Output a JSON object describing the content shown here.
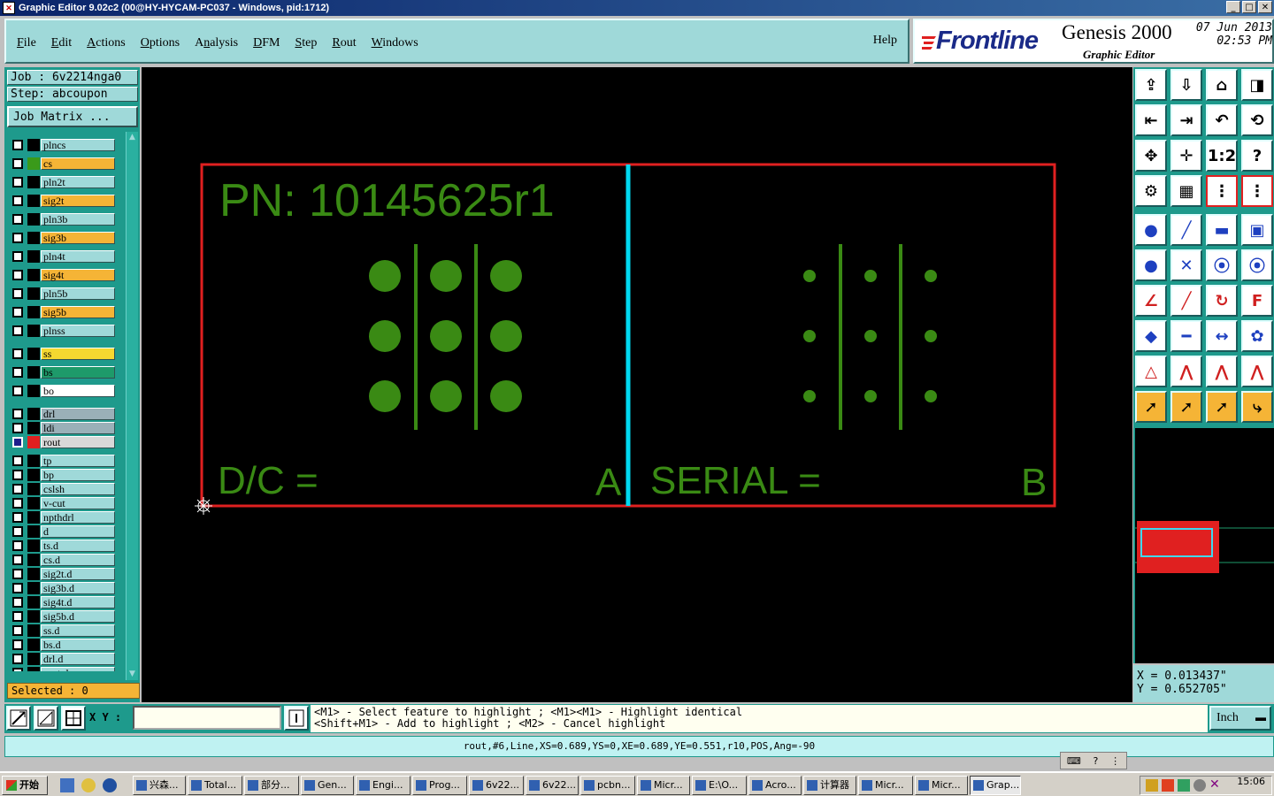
{
  "window": {
    "title": "Graphic Editor 9.02c2 (00@HY-HYCAM-PC037 - Windows, pid:1712)",
    "buttons": [
      "_",
      "□",
      "✕"
    ]
  },
  "menu": {
    "items": [
      {
        "label": "File",
        "u": "F"
      },
      {
        "label": "Edit",
        "u": "E"
      },
      {
        "label": "Actions",
        "u": "A"
      },
      {
        "label": "Options",
        "u": "O"
      },
      {
        "label": "Analysis",
        "u": "n"
      },
      {
        "label": "DFM",
        "u": "D"
      },
      {
        "label": "Step",
        "u": "S"
      },
      {
        "label": "Rout",
        "u": "R"
      },
      {
        "label": "Windows",
        "u": "W"
      }
    ],
    "help": "Help"
  },
  "logo": {
    "brand": "Frontline",
    "product": "Genesis 2000",
    "subtitle": "Graphic Editor",
    "date": "07 Jun 2013",
    "time": "02:53 PM"
  },
  "job": {
    "job_label": "Job : 6v2214nga0",
    "step_label": "Step: abcoupon",
    "matrix_button": "Job Matrix ..."
  },
  "layers": [
    {
      "name": "plncs",
      "color": "#000000",
      "bg": "#9fd9d9"
    },
    {
      "name": "cs",
      "color": "#3a9a1a",
      "bg": "#f5b436"
    },
    {
      "name": "pln2t",
      "color": "#000000",
      "bg": "#9fd9d9"
    },
    {
      "name": "sig2t",
      "color": "#000000",
      "bg": "#f5b436"
    },
    {
      "name": "pln3b",
      "color": "#000000",
      "bg": "#9fd9d9"
    },
    {
      "name": "sig3b",
      "color": "#000000",
      "bg": "#f5b436"
    },
    {
      "name": "pln4t",
      "color": "#000000",
      "bg": "#9fd9d9"
    },
    {
      "name": "sig4t",
      "color": "#000000",
      "bg": "#f5b436"
    },
    {
      "name": "pln5b",
      "color": "#000000",
      "bg": "#9fd9d9"
    },
    {
      "name": "sig5b",
      "color": "#000000",
      "bg": "#f5b436"
    },
    {
      "name": "plnss",
      "color": "#000000",
      "bg": "#9fd9d9"
    },
    {
      "name": "ss",
      "color": "#000000",
      "bg": "#f5d830"
    },
    {
      "name": "bs",
      "color": "#000000",
      "bg": "#1e9a6a"
    },
    {
      "name": "bo",
      "color": "#000000",
      "bg": "#ffffff"
    },
    {
      "name": "drl",
      "color": "#000000",
      "bg": "#9ab0b8"
    },
    {
      "name": "ldi",
      "color": "#000000",
      "bg": "#9ab0b8"
    },
    {
      "name": "rout",
      "color": "#e02020",
      "bg": "#d8d8d8",
      "selected": true
    },
    {
      "name": "tp",
      "color": "#000000",
      "bg": "#9fd9d9"
    },
    {
      "name": "bp",
      "color": "#000000",
      "bg": "#9fd9d9"
    },
    {
      "name": "cslsh",
      "color": "#000000",
      "bg": "#9fd9d9"
    },
    {
      "name": "v-cut",
      "color": "#000000",
      "bg": "#9fd9d9"
    },
    {
      "name": "npthdrl",
      "color": "#000000",
      "bg": "#9fd9d9"
    },
    {
      "name": "d",
      "color": "#000000",
      "bg": "#9fd9d9"
    },
    {
      "name": "ts.d",
      "color": "#000000",
      "bg": "#9fd9d9"
    },
    {
      "name": "cs.d",
      "color": "#000000",
      "bg": "#9fd9d9"
    },
    {
      "name": "sig2t.d",
      "color": "#000000",
      "bg": "#9fd9d9"
    },
    {
      "name": "sig3b.d",
      "color": "#000000",
      "bg": "#9fd9d9"
    },
    {
      "name": "sig4t.d",
      "color": "#000000",
      "bg": "#9fd9d9"
    },
    {
      "name": "sig5b.d",
      "color": "#000000",
      "bg": "#9fd9d9"
    },
    {
      "name": "ss.d",
      "color": "#000000",
      "bg": "#9fd9d9"
    },
    {
      "name": "bs.d",
      "color": "#000000",
      "bg": "#9fd9d9"
    },
    {
      "name": "drl.d",
      "color": "#000000",
      "bg": "#9fd9d9"
    },
    {
      "name": "rout.d",
      "color": "#000000",
      "bg": "#9fd9d9"
    }
  ],
  "selected_count": "Selected : 0",
  "board": {
    "pn_text": "PN: 10145625r1",
    "dc_text": "D/C =",
    "a_text": "A",
    "serial_text": "SERIAL =",
    "b_text": "B",
    "outline_color": "#e02020",
    "copper_color": "#3a8a14",
    "divider_color": "#00d8f0"
  },
  "coords": {
    "x": "X = 0.013437\"",
    "y": "Y = 0.652705\""
  },
  "cmd": {
    "xy_label": "X Y :",
    "xy_value": "",
    "hint_line1": "<M1> - Select feature to highlight ; <M1><M1> - Highlight identical",
    "hint_line2": "<Shift+M1> - Add to highlight ; <M2> - Cancel highlight",
    "unit": "Inch"
  },
  "status_line": "rout,#6,Line,XS=0.689,YS=0,XE=0.689,YE=0.551,r10,POS,Ang=-90",
  "taskbar": {
    "start": "开始",
    "buttons": [
      "兴森...",
      "Total...",
      "部分...",
      "Gen...",
      "Engi...",
      "Prog...",
      "6v22...",
      "6v22...",
      "pcbn...",
      "Micr...",
      "E:\\O...",
      "Acro...",
      "计算器",
      "Micr...",
      "Micr...",
      "Grap..."
    ],
    "active_index": 15,
    "clock": "15:06"
  }
}
